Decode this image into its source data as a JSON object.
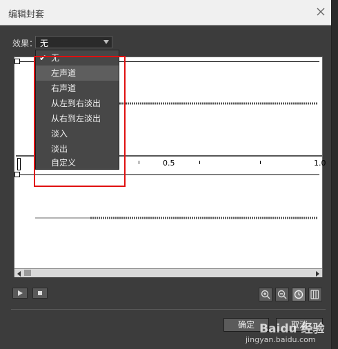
{
  "window": {
    "title": "编辑封套"
  },
  "effect": {
    "label": "效果：",
    "value": "无"
  },
  "dropdown": {
    "items": [
      {
        "label": "无",
        "checked": true
      },
      {
        "label": "左声道",
        "hovered": true
      },
      {
        "label": "右声道"
      },
      {
        "label": "从左到右淡出"
      },
      {
        "label": "从右到左淡出"
      },
      {
        "label": "淡入"
      },
      {
        "label": "淡出"
      },
      {
        "label": "自定义"
      }
    ]
  },
  "ruler": {
    "labels": [
      "0.5",
      "1.0"
    ]
  },
  "buttons": {
    "ok": "确定",
    "cancel": "取消"
  },
  "watermark": {
    "brand": "Baidu 经验",
    "url": "jingyan.baidu.com"
  },
  "colors": {
    "highlight": "#e01010",
    "dialog_bg": "#3c3c3c",
    "title_bg": "#f0f0f0"
  },
  "icons": [
    "close-icon",
    "dropdown-arrow-icon",
    "play-icon",
    "stop-icon",
    "zoom-in-icon",
    "zoom-out-icon",
    "time-units-icon",
    "frames-units-icon",
    "scroll-left-icon",
    "scroll-right-icon",
    "checkmark-icon"
  ]
}
